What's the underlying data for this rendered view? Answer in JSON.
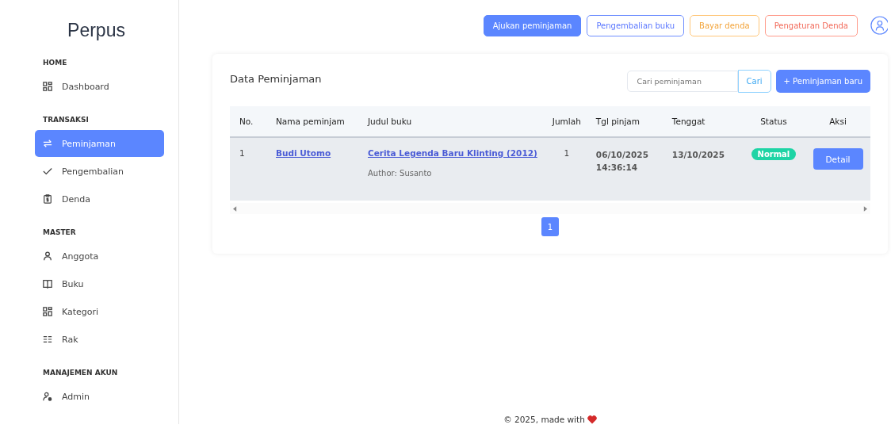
{
  "sidebar": {
    "brand": "Perpus",
    "sections": [
      {
        "title": "HOME",
        "items": [
          {
            "label": "Dashboard",
            "kind": "grid",
            "selected": false
          }
        ]
      },
      {
        "title": "TRANSAKSI",
        "items": [
          {
            "label": "Peminjaman",
            "kind": "swap",
            "selected": true
          },
          {
            "label": "Pengembalian",
            "kind": "check",
            "selected": false
          },
          {
            "label": "Denda",
            "kind": "receipt",
            "selected": false
          }
        ]
      },
      {
        "title": "MASTER",
        "items": [
          {
            "label": "Anggota",
            "kind": "person",
            "selected": false
          },
          {
            "label": "Buku",
            "kind": "book",
            "selected": false
          },
          {
            "label": "Kategori",
            "kind": "grid",
            "selected": false
          },
          {
            "label": "Rak",
            "kind": "list",
            "selected": false
          }
        ]
      },
      {
        "title": "MANAJEMEN AKUN",
        "items": [
          {
            "label": "Admin",
            "kind": "admin",
            "selected": false
          }
        ]
      }
    ]
  },
  "top_buttons": [
    {
      "label": "Ajukan peminjaman",
      "kind": "primary"
    },
    {
      "label": "Pengembalian buku",
      "kind": "blue"
    },
    {
      "label": "Bayar denda",
      "kind": "orange"
    },
    {
      "label": "Pengaturan Denda",
      "kind": "red"
    }
  ],
  "card": {
    "title": "Data Peminjaman",
    "search": {
      "placeholder": "Cari peminjaman",
      "button": "Cari"
    },
    "new_button": "+ Peminjaman baru",
    "table": {
      "columns": [
        "No.",
        "Nama peminjam",
        "Judul buku",
        "Jumlah",
        "Tgl pinjam",
        "Tenggat",
        "Status",
        "Aksi"
      ],
      "rows": [
        {
          "no": "1",
          "borrower": "Budi Utomo",
          "book": "Cerita Legenda Baru Klinting (2012)",
          "author": "Author: Susanto",
          "qty": "1",
          "borrowed": [
            "06/10/2025",
            "14:36:14"
          ],
          "due": "13/10/2025",
          "status": "Normal",
          "color": "#1ed4a5",
          "action": "Detail"
        }
      ]
    },
    "pagination": [
      {
        "label": "1",
        "selected": true
      }
    ]
  },
  "footer": "© 2025, made with"
}
